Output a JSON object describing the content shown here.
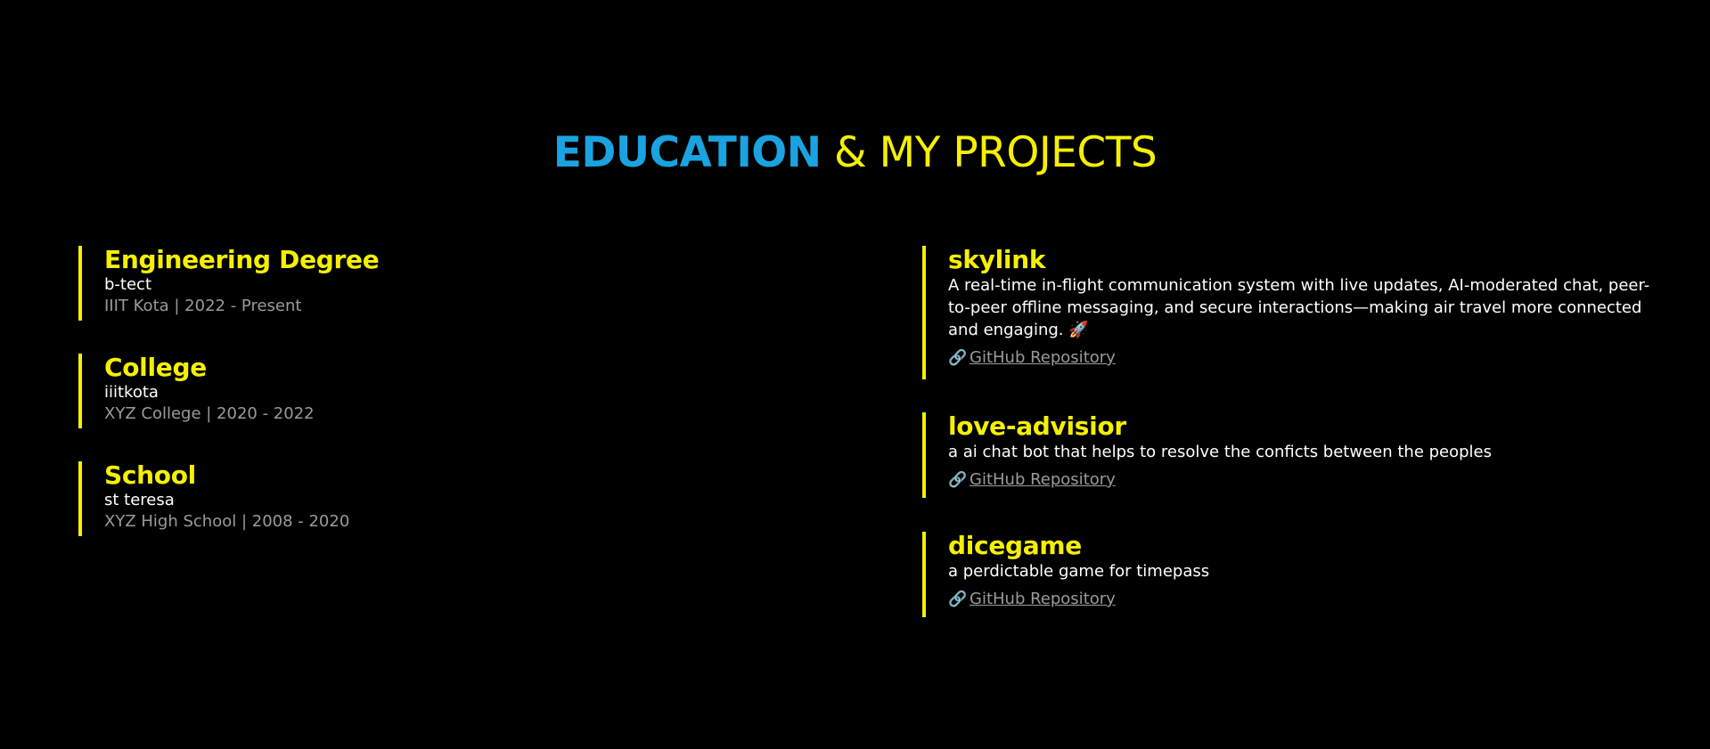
{
  "header": {
    "title_part1": "EDUCATION",
    "title_part2": " & MY PROJECTS"
  },
  "education": [
    {
      "title": "Engineering Degree",
      "subtitle": "b-tect",
      "meta": "IIIT Kota | 2022 - Present"
    },
    {
      "title": "College",
      "subtitle": "iiitkota",
      "meta": "XYZ College | 2020 - 2022"
    },
    {
      "title": "School",
      "subtitle": "st teresa",
      "meta": "XYZ High School | 2008 - 2020"
    }
  ],
  "projects": [
    {
      "title": "skylink",
      "description": "A real-time in-flight communication system with live updates, AI-moderated chat, peer-to-peer offline messaging, and secure interactions—making air travel more connected and engaging.",
      "emoji": "rocket-icon",
      "link_label": "GitHub Repository",
      "link_icon": "link-icon"
    },
    {
      "title": "love-advisior",
      "description": "a ai chat bot that helps to resolve the conficts between the peoples",
      "link_label": "GitHub Repository",
      "link_icon": "link-icon"
    },
    {
      "title": "dicegame",
      "description": "a perdictable game for timepass",
      "link_label": "GitHub Repository",
      "link_icon": "link-icon"
    }
  ],
  "colors": {
    "background": "#000000",
    "accent_blue": "#1aa3e0",
    "accent_yellow": "#f5f000",
    "muted": "#9a9a9a"
  }
}
